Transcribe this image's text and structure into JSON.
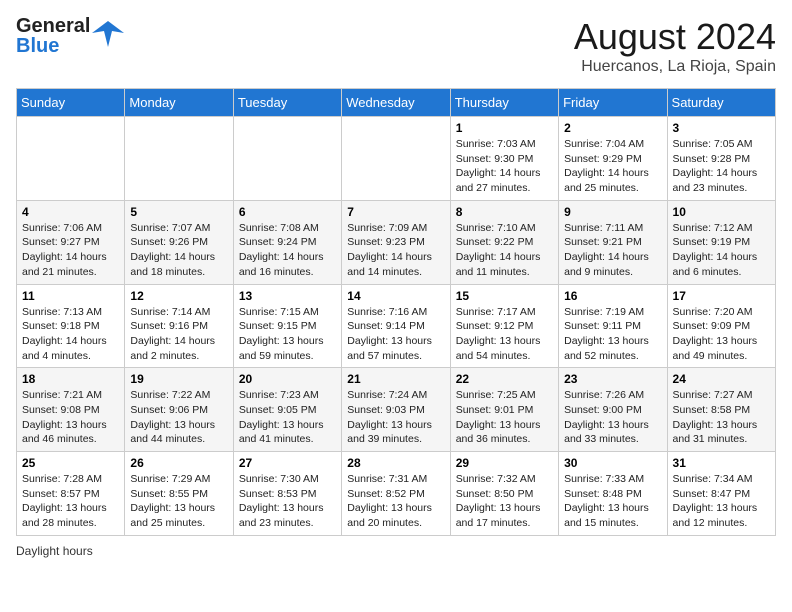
{
  "header": {
    "logo_general": "General",
    "logo_blue": "Blue",
    "month_year": "August 2024",
    "location": "Huercanos, La Rioja, Spain"
  },
  "days_of_week": [
    "Sunday",
    "Monday",
    "Tuesday",
    "Wednesday",
    "Thursday",
    "Friday",
    "Saturday"
  ],
  "weeks": [
    [
      {
        "day": "",
        "info": ""
      },
      {
        "day": "",
        "info": ""
      },
      {
        "day": "",
        "info": ""
      },
      {
        "day": "",
        "info": ""
      },
      {
        "day": "1",
        "info": "Sunrise: 7:03 AM\nSunset: 9:30 PM\nDaylight: 14 hours and 27 minutes."
      },
      {
        "day": "2",
        "info": "Sunrise: 7:04 AM\nSunset: 9:29 PM\nDaylight: 14 hours and 25 minutes."
      },
      {
        "day": "3",
        "info": "Sunrise: 7:05 AM\nSunset: 9:28 PM\nDaylight: 14 hours and 23 minutes."
      }
    ],
    [
      {
        "day": "4",
        "info": "Sunrise: 7:06 AM\nSunset: 9:27 PM\nDaylight: 14 hours and 21 minutes."
      },
      {
        "day": "5",
        "info": "Sunrise: 7:07 AM\nSunset: 9:26 PM\nDaylight: 14 hours and 18 minutes."
      },
      {
        "day": "6",
        "info": "Sunrise: 7:08 AM\nSunset: 9:24 PM\nDaylight: 14 hours and 16 minutes."
      },
      {
        "day": "7",
        "info": "Sunrise: 7:09 AM\nSunset: 9:23 PM\nDaylight: 14 hours and 14 minutes."
      },
      {
        "day": "8",
        "info": "Sunrise: 7:10 AM\nSunset: 9:22 PM\nDaylight: 14 hours and 11 minutes."
      },
      {
        "day": "9",
        "info": "Sunrise: 7:11 AM\nSunset: 9:21 PM\nDaylight: 14 hours and 9 minutes."
      },
      {
        "day": "10",
        "info": "Sunrise: 7:12 AM\nSunset: 9:19 PM\nDaylight: 14 hours and 6 minutes."
      }
    ],
    [
      {
        "day": "11",
        "info": "Sunrise: 7:13 AM\nSunset: 9:18 PM\nDaylight: 14 hours and 4 minutes."
      },
      {
        "day": "12",
        "info": "Sunrise: 7:14 AM\nSunset: 9:16 PM\nDaylight: 14 hours and 2 minutes."
      },
      {
        "day": "13",
        "info": "Sunrise: 7:15 AM\nSunset: 9:15 PM\nDaylight: 13 hours and 59 minutes."
      },
      {
        "day": "14",
        "info": "Sunrise: 7:16 AM\nSunset: 9:14 PM\nDaylight: 13 hours and 57 minutes."
      },
      {
        "day": "15",
        "info": "Sunrise: 7:17 AM\nSunset: 9:12 PM\nDaylight: 13 hours and 54 minutes."
      },
      {
        "day": "16",
        "info": "Sunrise: 7:19 AM\nSunset: 9:11 PM\nDaylight: 13 hours and 52 minutes."
      },
      {
        "day": "17",
        "info": "Sunrise: 7:20 AM\nSunset: 9:09 PM\nDaylight: 13 hours and 49 minutes."
      }
    ],
    [
      {
        "day": "18",
        "info": "Sunrise: 7:21 AM\nSunset: 9:08 PM\nDaylight: 13 hours and 46 minutes."
      },
      {
        "day": "19",
        "info": "Sunrise: 7:22 AM\nSunset: 9:06 PM\nDaylight: 13 hours and 44 minutes."
      },
      {
        "day": "20",
        "info": "Sunrise: 7:23 AM\nSunset: 9:05 PM\nDaylight: 13 hours and 41 minutes."
      },
      {
        "day": "21",
        "info": "Sunrise: 7:24 AM\nSunset: 9:03 PM\nDaylight: 13 hours and 39 minutes."
      },
      {
        "day": "22",
        "info": "Sunrise: 7:25 AM\nSunset: 9:01 PM\nDaylight: 13 hours and 36 minutes."
      },
      {
        "day": "23",
        "info": "Sunrise: 7:26 AM\nSunset: 9:00 PM\nDaylight: 13 hours and 33 minutes."
      },
      {
        "day": "24",
        "info": "Sunrise: 7:27 AM\nSunset: 8:58 PM\nDaylight: 13 hours and 31 minutes."
      }
    ],
    [
      {
        "day": "25",
        "info": "Sunrise: 7:28 AM\nSunset: 8:57 PM\nDaylight: 13 hours and 28 minutes."
      },
      {
        "day": "26",
        "info": "Sunrise: 7:29 AM\nSunset: 8:55 PM\nDaylight: 13 hours and 25 minutes."
      },
      {
        "day": "27",
        "info": "Sunrise: 7:30 AM\nSunset: 8:53 PM\nDaylight: 13 hours and 23 minutes."
      },
      {
        "day": "28",
        "info": "Sunrise: 7:31 AM\nSunset: 8:52 PM\nDaylight: 13 hours and 20 minutes."
      },
      {
        "day": "29",
        "info": "Sunrise: 7:32 AM\nSunset: 8:50 PM\nDaylight: 13 hours and 17 minutes."
      },
      {
        "day": "30",
        "info": "Sunrise: 7:33 AM\nSunset: 8:48 PM\nDaylight: 13 hours and 15 minutes."
      },
      {
        "day": "31",
        "info": "Sunrise: 7:34 AM\nSunset: 8:47 PM\nDaylight: 13 hours and 12 minutes."
      }
    ]
  ],
  "footer": {
    "daylight_label": "Daylight hours"
  }
}
